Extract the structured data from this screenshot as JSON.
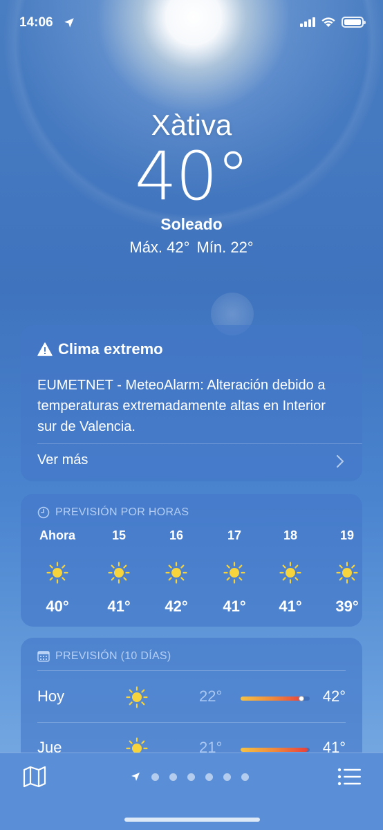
{
  "status": {
    "time": "14:06",
    "icons": [
      "location-arrow-icon",
      "cellular-signal-icon",
      "wifi-icon",
      "battery-icon"
    ]
  },
  "location": {
    "city": "Xàtiva",
    "temperature": "40°",
    "condition": "Soleado",
    "high": "Máx. 42°",
    "low": "Mín. 22°"
  },
  "alert": {
    "icon": "warning-triangle-icon",
    "title": "Clima extremo",
    "body": "EUMETNET - MeteoAlarm: Alteración debido a temperaturas extremadamente altas en Interior sur de Valencia.",
    "more": "Ver más"
  },
  "hourly": {
    "icon": "clock-icon",
    "title": "PREVISIÓN POR HORAS",
    "hours": [
      {
        "label": "Ahora",
        "icon": "sun-icon",
        "temp": "40°"
      },
      {
        "label": "15",
        "icon": "sun-icon",
        "temp": "41°"
      },
      {
        "label": "16",
        "icon": "sun-icon",
        "temp": "42°"
      },
      {
        "label": "17",
        "icon": "sun-icon",
        "temp": "41°"
      },
      {
        "label": "18",
        "icon": "sun-icon",
        "temp": "41°"
      },
      {
        "label": "19",
        "icon": "sun-icon",
        "temp": "39°"
      }
    ]
  },
  "daily": {
    "icon": "calendar-icon",
    "title": "PREVISIÓN (10 DÍAS)",
    "days": [
      {
        "name": "Hoy",
        "icon": "sun-icon",
        "low": "22°",
        "high": "42°",
        "range_start": 0.0,
        "range_end": 0.92,
        "current": 0.88
      },
      {
        "name": "Jue",
        "icon": "sun-icon",
        "low": "21°",
        "high": "41°",
        "range_start": 0.0,
        "range_end": 0.97
      }
    ]
  },
  "colors": {
    "sky_top": "#4a7ec2",
    "sky_bottom": "#82b1e6",
    "sun_icon": "#f7d33c",
    "bar_warm": "#f6c244",
    "bar_hot": "#e8413c"
  },
  "bottom": {
    "left_icon": "map-icon",
    "right_icon": "list-icon",
    "pages_after_location": 6
  }
}
